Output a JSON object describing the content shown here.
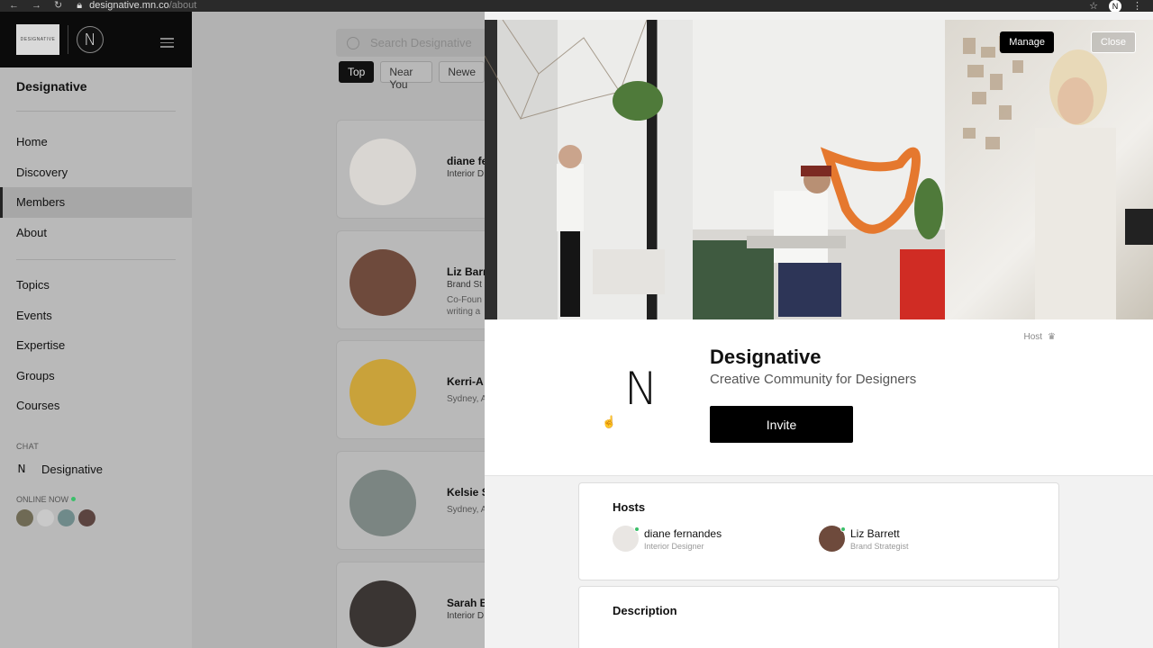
{
  "browser": {
    "url_host": "designative.mn.co",
    "url_path": "/about",
    "profile_letter": "N"
  },
  "sidebar": {
    "logo_text": "DESIGNATIVE",
    "badge_letter": "N",
    "community_name": "Designative",
    "nav_primary": [
      "Home",
      "Discovery",
      "Members",
      "About"
    ],
    "active_item": "Members",
    "nav_secondary": [
      "Topics",
      "Events",
      "Expertise",
      "Groups",
      "Courses"
    ],
    "chat_label": "CHAT",
    "chat_item": {
      "letter": "N",
      "label": "Designative"
    },
    "online_label": "ONLINE NOW",
    "online_avatar_colors": [
      "#6f6a55",
      "#c9c9c9",
      "#6f8a8a",
      "#5b4440"
    ]
  },
  "main": {
    "search_placeholder": "Search Designative",
    "filters": [
      "Top",
      "Near You",
      "Newe"
    ],
    "members": [
      {
        "name": "diane fe",
        "role": "Interior D",
        "desc": "",
        "color": "#d9d6d2"
      },
      {
        "name": "Liz Barr",
        "role": "Brand St",
        "desc": "Co-Foun\nwriting a",
        "color": "#6e4a3c"
      },
      {
        "name": "Kerri-A",
        "role": "",
        "desc": "Sydney, A",
        "color": "#c9a23a"
      },
      {
        "name": "Kelsie S",
        "role": "",
        "desc": "Sydney, A",
        "color": "#7b8582"
      },
      {
        "name": "Sarah B",
        "role": "Interior D",
        "desc": "",
        "color": "#3a3533"
      }
    ]
  },
  "panel": {
    "manage_label": "Manage",
    "close_label": "Close",
    "host_label": "Host",
    "logo_letter": "N",
    "title": "Designative",
    "tagline": "Creative Community for Designers",
    "invite_label": "Invite",
    "hosts_heading": "Hosts",
    "hosts": [
      {
        "name": "diane fernandes",
        "role": "Interior Designer",
        "color": "#e9e6e3"
      },
      {
        "name": "Liz Barrett",
        "role": "Brand Strategist",
        "color": "#6e4a3c"
      }
    ],
    "description_heading": "Description"
  }
}
